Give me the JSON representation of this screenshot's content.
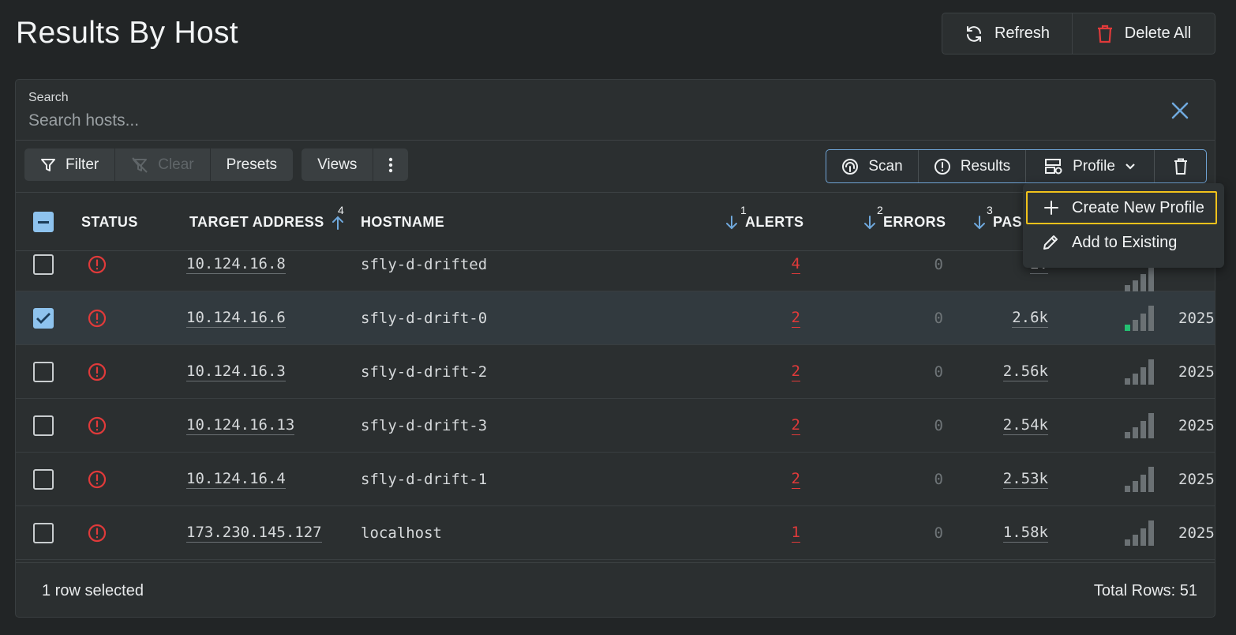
{
  "page": {
    "title": "Results By Host"
  },
  "top_actions": {
    "refresh_label": "Refresh",
    "delete_all_label": "Delete All"
  },
  "search": {
    "label": "Search",
    "placeholder": "Search hosts..."
  },
  "toolbar": {
    "filter_label": "Filter",
    "clear_label": "Clear",
    "presets_label": "Presets",
    "views_label": "Views",
    "scan_label": "Scan",
    "results_label": "Results",
    "profile_label": "Profile"
  },
  "table": {
    "headers": {
      "status": "STATUS",
      "target_address": "TARGET ADDRESS",
      "target_address_sort": "4",
      "hostname": "HOSTNAME",
      "alerts": "ALERTS",
      "alerts_sort": "1",
      "errors": "ERRORS",
      "errors_sort": "2",
      "passed": "PAS",
      "passed_sort": "3"
    },
    "rows": [
      {
        "address": "10.124.16.8",
        "hostname": "sfly-d-drifted",
        "alerts": "4",
        "errors": "0",
        "passed": "2.",
        "date": "",
        "selected": false,
        "signal": 0
      },
      {
        "address": "10.124.16.6",
        "hostname": "sfly-d-drift-0",
        "alerts": "2",
        "errors": "0",
        "passed": "2.6k",
        "date": "2025",
        "selected": true,
        "signal": 1
      },
      {
        "address": "10.124.16.3",
        "hostname": "sfly-d-drift-2",
        "alerts": "2",
        "errors": "0",
        "passed": "2.56k",
        "date": "2025",
        "selected": false,
        "signal": 0
      },
      {
        "address": "10.124.16.13",
        "hostname": "sfly-d-drift-3",
        "alerts": "2",
        "errors": "0",
        "passed": "2.54k",
        "date": "2025",
        "selected": false,
        "signal": 0
      },
      {
        "address": "10.124.16.4",
        "hostname": "sfly-d-drift-1",
        "alerts": "2",
        "errors": "0",
        "passed": "2.53k",
        "date": "2025",
        "selected": false,
        "signal": 0
      },
      {
        "address": "173.230.145.127",
        "hostname": "localhost",
        "alerts": "1",
        "errors": "0",
        "passed": "1.58k",
        "date": "2025",
        "selected": false,
        "signal": 0
      }
    ]
  },
  "footer": {
    "selection_text": "1 row selected",
    "total_rows_text": "Total Rows: 51"
  },
  "profile_menu": {
    "create_label": "Create New Profile",
    "add_label": "Add to Existing"
  },
  "colors": {
    "accent": "#8ec3ee",
    "alert_red": "#e03a3a",
    "focus_yellow": "#f1c21b",
    "signal_green": "#24c072"
  }
}
